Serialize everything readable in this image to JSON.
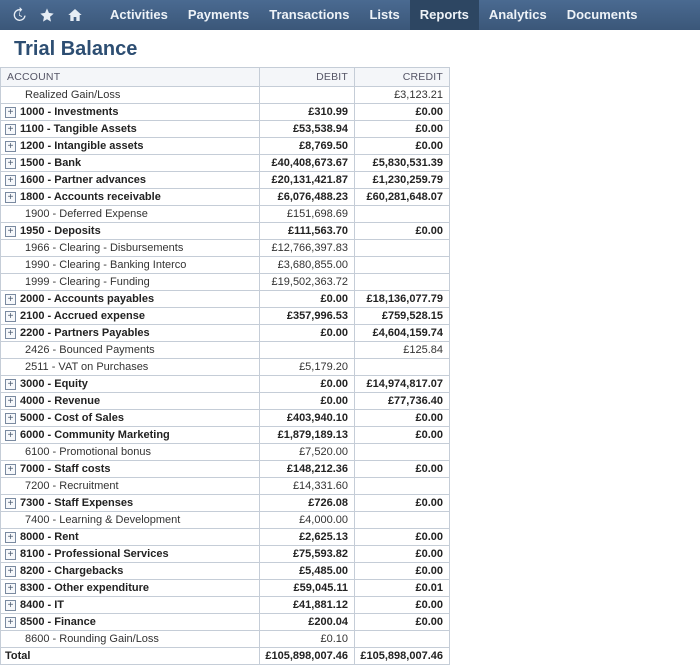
{
  "nav": {
    "tabs": [
      {
        "label": "Activities",
        "active": false
      },
      {
        "label": "Payments",
        "active": false
      },
      {
        "label": "Transactions",
        "active": false
      },
      {
        "label": "Lists",
        "active": false
      },
      {
        "label": "Reports",
        "active": true
      },
      {
        "label": "Analytics",
        "active": false
      },
      {
        "label": "Documents",
        "active": false
      }
    ]
  },
  "page": {
    "title": "Trial Balance"
  },
  "table": {
    "headers": {
      "account": "ACCOUNT",
      "debit": "DEBIT",
      "credit": "CREDIT"
    },
    "rows": [
      {
        "expand": false,
        "bold": false,
        "child": true,
        "account": "Realized Gain/Loss",
        "debit": "",
        "credit": "£3,123.21"
      },
      {
        "expand": true,
        "bold": true,
        "child": false,
        "account": "1000 - Investments",
        "debit": "£310.99",
        "credit": "£0.00"
      },
      {
        "expand": true,
        "bold": true,
        "child": false,
        "account": "1100 - Tangible Assets",
        "debit": "£53,538.94",
        "credit": "£0.00"
      },
      {
        "expand": true,
        "bold": true,
        "child": false,
        "account": "1200 - Intangible assets",
        "debit": "£8,769.50",
        "credit": "£0.00"
      },
      {
        "expand": true,
        "bold": true,
        "child": false,
        "account": "1500 - Bank",
        "debit": "£40,408,673.67",
        "credit": "£5,830,531.39"
      },
      {
        "expand": true,
        "bold": true,
        "child": false,
        "account": "1600 - Partner advances",
        "debit": "£20,131,421.87",
        "credit": "£1,230,259.79"
      },
      {
        "expand": true,
        "bold": true,
        "child": false,
        "account": "1800 - Accounts receivable",
        "debit": "£6,076,488.23",
        "credit": "£60,281,648.07"
      },
      {
        "expand": false,
        "bold": false,
        "child": true,
        "account": "1900 - Deferred Expense",
        "debit": "£151,698.69",
        "credit": ""
      },
      {
        "expand": true,
        "bold": true,
        "child": false,
        "account": "1950 - Deposits",
        "debit": "£111,563.70",
        "credit": "£0.00"
      },
      {
        "expand": false,
        "bold": false,
        "child": true,
        "account": "1966 - Clearing - Disbursements",
        "debit": "£12,766,397.83",
        "credit": ""
      },
      {
        "expand": false,
        "bold": false,
        "child": true,
        "account": "1990 - Clearing - Banking Interco",
        "debit": "£3,680,855.00",
        "credit": ""
      },
      {
        "expand": false,
        "bold": false,
        "child": true,
        "account": "1999 - Clearing - Funding",
        "debit": "£19,502,363.72",
        "credit": ""
      },
      {
        "expand": true,
        "bold": true,
        "child": false,
        "account": "2000 - Accounts payables",
        "debit": "£0.00",
        "credit": "£18,136,077.79"
      },
      {
        "expand": true,
        "bold": true,
        "child": false,
        "account": "2100 - Accrued expense",
        "debit": "£357,996.53",
        "credit": "£759,528.15"
      },
      {
        "expand": true,
        "bold": true,
        "child": false,
        "account": "2200 - Partners Payables",
        "debit": "£0.00",
        "credit": "£4,604,159.74"
      },
      {
        "expand": false,
        "bold": false,
        "child": true,
        "account": "2426 - Bounced Payments",
        "debit": "",
        "credit": "£125.84"
      },
      {
        "expand": false,
        "bold": false,
        "child": true,
        "account": "2511 - VAT on Purchases",
        "debit": "£5,179.20",
        "credit": ""
      },
      {
        "expand": true,
        "bold": true,
        "child": false,
        "account": "3000 - Equity",
        "debit": "£0.00",
        "credit": "£14,974,817.07"
      },
      {
        "expand": true,
        "bold": true,
        "child": false,
        "account": "4000 - Revenue",
        "debit": "£0.00",
        "credit": "£77,736.40"
      },
      {
        "expand": true,
        "bold": true,
        "child": false,
        "account": "5000 - Cost of Sales",
        "debit": "£403,940.10",
        "credit": "£0.00"
      },
      {
        "expand": true,
        "bold": true,
        "child": false,
        "account": "6000 - Community Marketing",
        "debit": "£1,879,189.13",
        "credit": "£0.00"
      },
      {
        "expand": false,
        "bold": false,
        "child": true,
        "account": "6100 - Promotional bonus",
        "debit": "£7,520.00",
        "credit": ""
      },
      {
        "expand": true,
        "bold": true,
        "child": false,
        "account": "7000 - Staff costs",
        "debit": "£148,212.36",
        "credit": "£0.00"
      },
      {
        "expand": false,
        "bold": false,
        "child": true,
        "account": "7200 - Recruitment",
        "debit": "£14,331.60",
        "credit": ""
      },
      {
        "expand": true,
        "bold": true,
        "child": false,
        "account": "7300 - Staff Expenses",
        "debit": "£726.08",
        "credit": "£0.00"
      },
      {
        "expand": false,
        "bold": false,
        "child": true,
        "account": "7400 - Learning & Development",
        "debit": "£4,000.00",
        "credit": ""
      },
      {
        "expand": true,
        "bold": true,
        "child": false,
        "account": "8000 - Rent",
        "debit": "£2,625.13",
        "credit": "£0.00"
      },
      {
        "expand": true,
        "bold": true,
        "child": false,
        "account": "8100 - Professional Services",
        "debit": "£75,593.82",
        "credit": "£0.00"
      },
      {
        "expand": true,
        "bold": true,
        "child": false,
        "account": "8200 - Chargebacks",
        "debit": "£5,485.00",
        "credit": "£0.00"
      },
      {
        "expand": true,
        "bold": true,
        "child": false,
        "account": "8300 - Other expenditure",
        "debit": "£59,045.11",
        "credit": "£0.01"
      },
      {
        "expand": true,
        "bold": true,
        "child": false,
        "account": "8400 - IT",
        "debit": "£41,881.12",
        "credit": "£0.00"
      },
      {
        "expand": true,
        "bold": true,
        "child": false,
        "account": "8500 - Finance",
        "debit": "£200.04",
        "credit": "£0.00"
      },
      {
        "expand": false,
        "bold": false,
        "child": true,
        "account": "8600 - Rounding Gain/Loss",
        "debit": "£0.10",
        "credit": ""
      }
    ],
    "total": {
      "label": "Total",
      "debit": "£105,898,007.46",
      "credit": "£105,898,007.46"
    }
  }
}
